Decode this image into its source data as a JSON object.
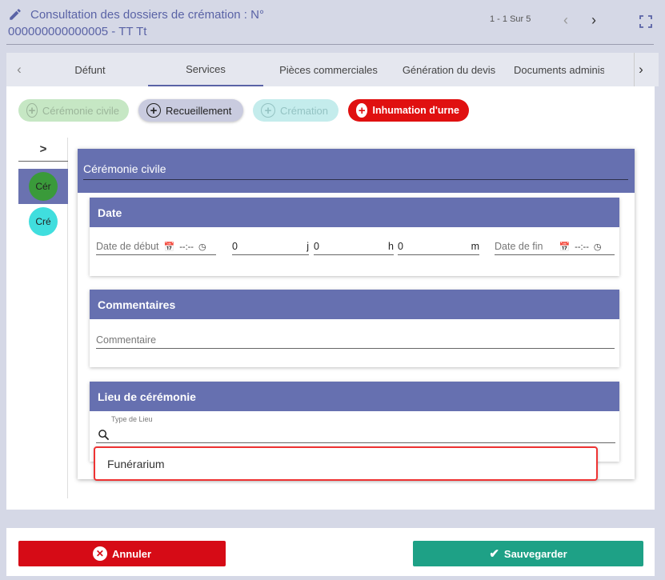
{
  "header": {
    "title": "Consultation des dossiers de crémation : N° 000000000000005 - TT Tt",
    "pager": "1 - 1 Sur 5",
    "icons": {
      "edit": "pencil-icon",
      "prev": "chevron-left-icon",
      "next": "chevron-right-icon",
      "fullscreen": "fullscreen-icon"
    }
  },
  "tabs": {
    "items": [
      {
        "label": "Défunt"
      },
      {
        "label": "Services"
      },
      {
        "label": "Pièces commerciales"
      },
      {
        "label": "Génération du devis"
      },
      {
        "label": "Documents administ"
      }
    ],
    "active": "Services"
  },
  "chips": {
    "ceremonie": "Cérémonie civile",
    "recueillement": "Recueillement",
    "cremation": "Crémation",
    "inhumation": "Inhumation d'urne"
  },
  "stepper": {
    "toggle": ">",
    "steps": [
      {
        "label": "Cér",
        "color": "#3a9a3a",
        "active": true
      },
      {
        "label": "Cré",
        "color": "#40dede",
        "active": false
      }
    ]
  },
  "section": {
    "title": "Cérémonie civile",
    "date": {
      "title": "Date",
      "start_placeholder": "Date de début",
      "start_time": "--:--",
      "days": "0",
      "days_unit": "j",
      "hours": "0",
      "hours_unit": "h",
      "minutes": "0",
      "minutes_unit": "m",
      "end_placeholder": "Date de fin",
      "end_time": "--:--"
    },
    "comments": {
      "title": "Commentaires",
      "placeholder": "Commentaire"
    },
    "lieu": {
      "title": "Lieu de cérémonie",
      "type_label": "Type de Lieu",
      "option": "Funérarium"
    }
  },
  "footer": {
    "cancel": "Annuler",
    "save": "Sauvegarder"
  },
  "colors": {
    "primary": "#6670b0",
    "danger": "#d60b16",
    "success": "#1ea186"
  }
}
